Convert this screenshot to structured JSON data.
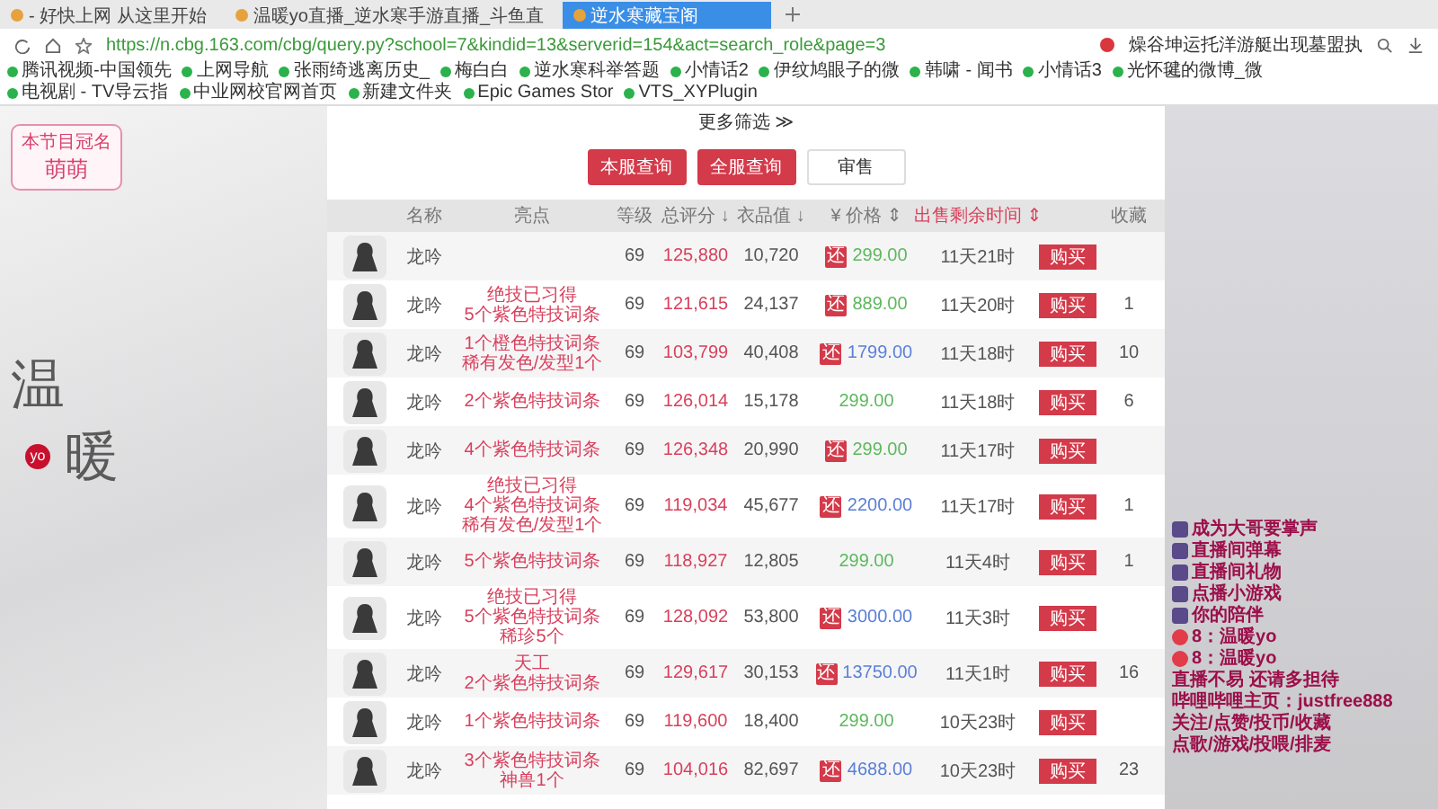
{
  "browser": {
    "tabs": [
      {
        "title": "- 好快上网 从这里开始",
        "selected": false
      },
      {
        "title": "温暖yo直播_逆水寒手游直播_斗鱼直",
        "selected": false
      },
      {
        "title": "逆水寒藏宝阁",
        "selected": true
      }
    ],
    "address": "https://n.cbg.163.com/cbg/query.py?school=7&kindid=13&serverid=154&act=search_role&page=3",
    "search_hint": "燥谷坤运托洋游艇出现墓盟执",
    "bookmarks": [
      "腾讯视频-中国领先",
      "上网导航",
      "张雨绮逃离历史_",
      "梅白白",
      "逆水寒科举答题",
      "小情话2",
      "伊纹鸠眼子的微",
      "韩啸 - 闻书",
      "小情话3",
      "光怀毽的微博_微",
      "电视剧 - TV导云指",
      "中业网校官网首页",
      "新建文件夹",
      "Epic Games Stor",
      "VTS_XYPlugin"
    ]
  },
  "overlay": {
    "sponsor_title": "本节目冠名",
    "sponsor_name": "萌萌",
    "logo_chars": [
      "温",
      "暖"
    ],
    "logo_badge": "yo",
    "chat": [
      {
        "kind": "icon",
        "text": "成为大哥要掌声"
      },
      {
        "kind": "icon",
        "text": "直播间弹幕"
      },
      {
        "kind": "icon",
        "text": "直播间礼物"
      },
      {
        "kind": "icon",
        "text": "点播小游戏"
      },
      {
        "kind": "icon",
        "text": "你的陪伴"
      },
      {
        "kind": "platform",
        "text": "8：温暖yo"
      },
      {
        "kind": "platform",
        "text": "8：温暖yo"
      },
      {
        "kind": "plain",
        "text": "直播不易 还请多担待"
      },
      {
        "kind": "plain",
        "text": "哔哩哔哩主页：justfree888"
      },
      {
        "kind": "plain",
        "text": "关注/点赞/投币/收藏"
      },
      {
        "kind": "plain",
        "text": "点歌/游戏/投喂/排麦"
      }
    ]
  },
  "filter_toggle": "更多筛选 ≫",
  "query_buttons": [
    {
      "label": "本服查询",
      "kind": "primary"
    },
    {
      "label": "全服查询",
      "kind": "primary"
    },
    {
      "label": "审售",
      "kind": "plain"
    }
  ],
  "table": {
    "columns": [
      {
        "label": "名称",
        "sort": false
      },
      {
        "label": "亮点",
        "sort": false
      },
      {
        "label": "等级",
        "sort": false
      },
      {
        "label": "总评分 ↓",
        "sort": false
      },
      {
        "label": "衣品值 ↓",
        "sort": false
      },
      {
        "label": "¥ 价格 ⇕",
        "sort": false
      },
      {
        "label": "出售剩余时间 ⇕",
        "sort": true
      },
      {
        "label": "收藏",
        "sort": false
      }
    ],
    "rows": [
      {
        "name": "龙吟",
        "highlights": [],
        "level": "69",
        "score": "125,880",
        "outfit": "10,720",
        "refund_label": "还",
        "price": "299.00",
        "color": "#5cb85c",
        "time": "11天21时",
        "buy": "购买",
        "fav": ""
      },
      {
        "name": "龙吟",
        "highlights": [
          "绝技已习得",
          "5个紫色特技词条"
        ],
        "level": "69",
        "score": "121,615",
        "outfit": "24,137",
        "refund_label": "还",
        "price": "889.00",
        "color": "#5cb85c",
        "time": "11天20时",
        "buy": "购买",
        "fav": "1"
      },
      {
        "name": "龙吟",
        "highlights": [
          "1个橙色特技词条",
          "稀有发色/发型1个"
        ],
        "level": "69",
        "score": "103,799",
        "outfit": "40,408",
        "refund_label": "还",
        "price": "1799.00",
        "color": "#5b7fd6",
        "time": "11天18时",
        "buy": "购买",
        "fav": "10"
      },
      {
        "name": "龙吟",
        "highlights": [
          "2个紫色特技词条"
        ],
        "level": "69",
        "score": "126,014",
        "outfit": "15,178",
        "price": "299.00",
        "color": "#5cb85c",
        "time": "11天18时",
        "buy": "购买",
        "fav": "6"
      },
      {
        "name": "龙吟",
        "highlights": [
          "4个紫色特技词条"
        ],
        "level": "69",
        "score": "126,348",
        "outfit": "20,990",
        "refund_label": "还",
        "price": "299.00",
        "color": "#5cb85c",
        "time": "11天17时",
        "buy": "购买",
        "fav": ""
      },
      {
        "name": "龙吟",
        "highlights": [
          "绝技已习得",
          "4个紫色特技词条",
          "稀有发色/发型1个"
        ],
        "level": "69",
        "score": "119,034",
        "outfit": "45,677",
        "refund_label": "还",
        "price": "2200.00",
        "color": "#5b7fd6",
        "time": "11天17时",
        "buy": "购买",
        "fav": "1"
      },
      {
        "name": "龙吟",
        "highlights": [
          "5个紫色特技词条"
        ],
        "level": "69",
        "score": "118,927",
        "outfit": "12,805",
        "price": "299.00",
        "color": "#5cb85c",
        "time": "11天4时",
        "buy": "购买",
        "fav": "1"
      },
      {
        "name": "龙吟",
        "highlights": [
          "绝技已习得",
          "5个紫色特技词条",
          "稀珍5个"
        ],
        "level": "69",
        "score": "128,092",
        "outfit": "53,800",
        "refund_label": "还",
        "price": "3000.00",
        "color": "#5b7fd6",
        "time": "11天3时",
        "buy": "购买",
        "fav": ""
      },
      {
        "name": "龙吟",
        "highlights": [
          "天工",
          "2个紫色特技词条"
        ],
        "level": "69",
        "score": "129,617",
        "outfit": "30,153",
        "refund_label": "还",
        "price": "13750.00",
        "color": "#5b7fd6",
        "time": "11天1时",
        "buy": "购买",
        "fav": "16"
      },
      {
        "name": "龙吟",
        "highlights": [
          "1个紫色特技词条"
        ],
        "level": "69",
        "score": "119,600",
        "outfit": "18,400",
        "price": "299.00",
        "color": "#5cb85c",
        "time": "10天23时",
        "buy": "购买",
        "fav": ""
      },
      {
        "name": "龙吟",
        "highlights": [
          "3个紫色特技词条",
          "神兽1个"
        ],
        "level": "69",
        "score": "104,016",
        "outfit": "82,697",
        "refund_label": "还",
        "price": "4688.00",
        "color": "#5b7fd6",
        "time": "10天23时",
        "buy": "购买",
        "fav": "23"
      }
    ]
  }
}
